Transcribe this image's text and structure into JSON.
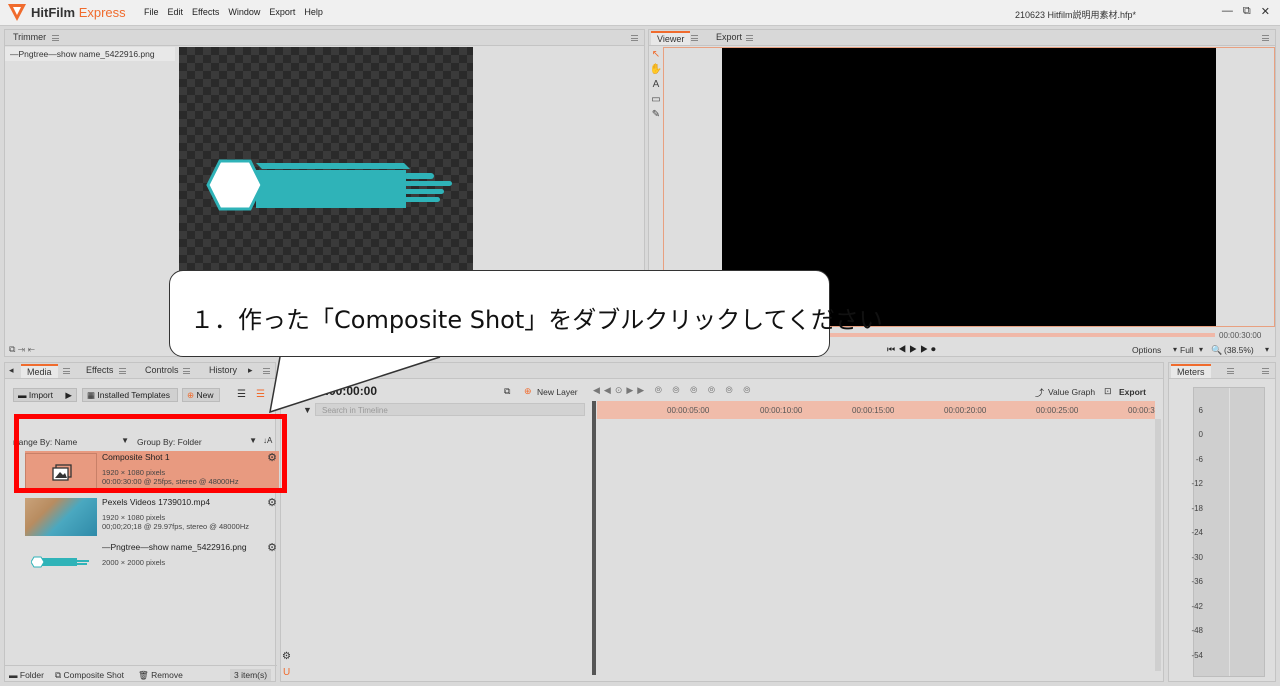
{
  "app": {
    "name": "HitFilm",
    "name_suffix": "Express",
    "doc_title": "210623 Hitfilm説明用素材.hfp*"
  },
  "menu": [
    "File",
    "Edit",
    "Effects",
    "Window",
    "Export",
    "Help"
  ],
  "window_controls": [
    "—",
    "⧉",
    "✕"
  ],
  "trimmer": {
    "tab": "Trimmer",
    "file_tab": "—Pngtree—show name_5422916.png"
  },
  "viewer": {
    "tabs": [
      "Viewer",
      "Export"
    ],
    "time": "00:00:30:00",
    "options": "Options",
    "quality": "Full",
    "zoom": "(38.5%)"
  },
  "callout": {
    "text": "１．作った「Composite Shot」をダブルクリックしてください"
  },
  "media_panel": {
    "tabs": [
      "Media",
      "Effects",
      "Controls",
      "History"
    ],
    "import_label": "Import",
    "templates_label": "Installed Templates",
    "new_label": "New",
    "arrange_label": "rrange By: Name",
    "group_label": "Group By: Folder",
    "items": [
      {
        "name": "Composite Shot 1",
        "line1": "1920 × 1080 pixels",
        "line2": "00:00:30:00 @ 25fps, stereo @ 48000Hz"
      },
      {
        "name": "Pexels Videos 1739010.mp4",
        "line1": "1920 × 1080 pixels",
        "line2": "00;00;20;18 @ 29.97fps, stereo @ 48000Hz"
      },
      {
        "name": "—Pngtree—show name_5422916.png",
        "line1": "2000 × 2000 pixels",
        "line2": ""
      }
    ],
    "footer": {
      "folder": "Folder",
      "composite": "Composite Shot",
      "remove": "Remove",
      "count": "3 item(s)"
    }
  },
  "timeline": {
    "timecode": ":00:00:00",
    "new_layer": "New Layer",
    "search_placeholder": "Search in Timeline",
    "value_graph": "Value Graph",
    "export": "Export",
    "ruler": [
      "00:00:05:00",
      "00:00:10:00",
      "00:00:15:00",
      "00:00:20:00",
      "00:00:25:00",
      "00:00:3"
    ]
  },
  "meters": {
    "tab": "Meters",
    "scale": [
      "6",
      "0",
      "-6",
      "-12",
      "-18",
      "-24",
      "-30",
      "-36",
      "-42",
      "-48",
      "-54"
    ]
  },
  "colors": {
    "accent": "#f06b2d",
    "highlight_row": "#e89a80",
    "annotation_red": "#ff0000",
    "shape_teal": "#2fb3b8"
  }
}
